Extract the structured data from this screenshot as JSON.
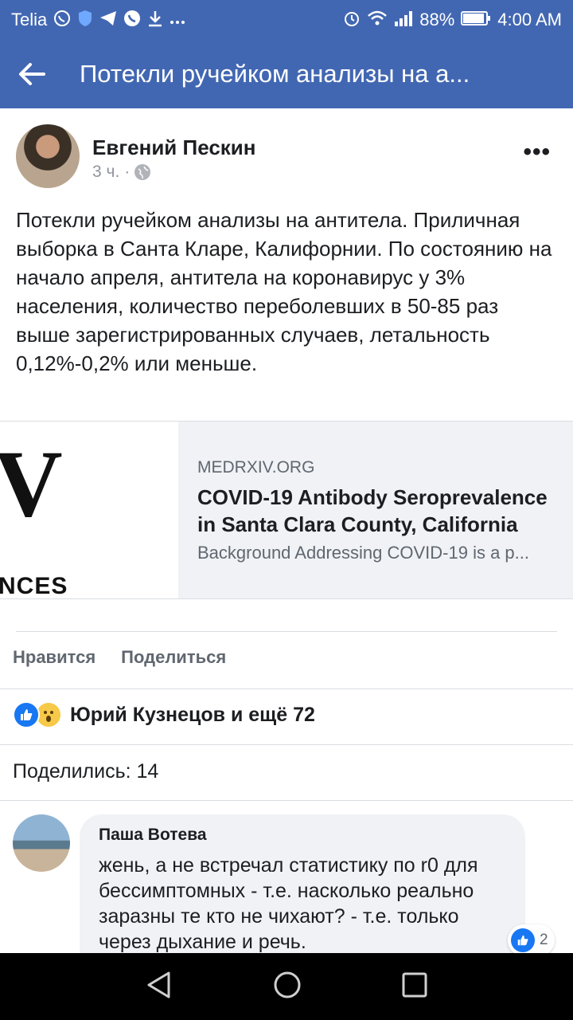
{
  "status_bar": {
    "carrier": "Telia",
    "battery": "88%",
    "time": "4:00 AM"
  },
  "app_bar": {
    "title": "Потекли ручейком анализы на а..."
  },
  "post": {
    "author": "Евгений Пескин",
    "time": "3 ч.",
    "separator": "·",
    "more": "•••",
    "text": "Потекли ручейком анализы на антитела. Приличная выборка в Санта Кларе, Калифорнии. По состоянию на начало апреля, антитела на коронавирус у 3% населения, количество переболевших в 50-85 раз выше зарегистрированных случаев, летальность 0,12%-0,2% или меньше."
  },
  "link": {
    "thumb_v": "V",
    "thumb_text": "NCES",
    "domain": "MEDRXIV.ORG",
    "title": "COVID-19 Antibody Seroprevalence in Santa Clara County, California",
    "description": "Background Addressing COVID-19 is a p..."
  },
  "actions": {
    "like": "Нравится",
    "share": "Поделиться"
  },
  "reactions": {
    "text": "Юрий Кузнецов и ещё 72"
  },
  "shares": {
    "text": "Поделились: 14"
  },
  "comment": {
    "author": "Паша Вотева",
    "text": "жень, а не встречал статистику по r0 для бессимптомных - т.е. насколько реально заразны те кто не чихают? - т.е. только через дыхание и речь.",
    "reaction_count": "2"
  },
  "colors": {
    "brand": "#4267b2",
    "like_blue": "#1877f2"
  }
}
